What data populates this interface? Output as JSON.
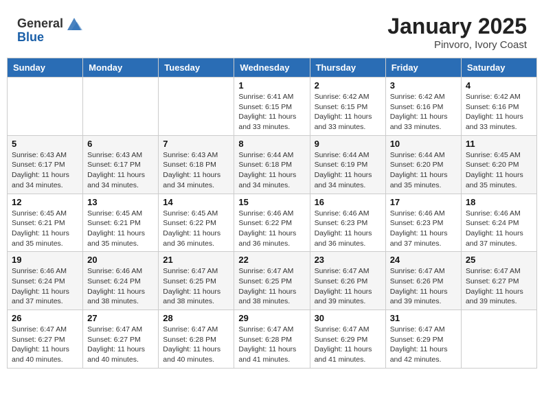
{
  "header": {
    "logo_general": "General",
    "logo_blue": "Blue",
    "month_year": "January 2025",
    "location": "Pinvoro, Ivory Coast"
  },
  "weekdays": [
    "Sunday",
    "Monday",
    "Tuesday",
    "Wednesday",
    "Thursday",
    "Friday",
    "Saturday"
  ],
  "weeks": [
    [
      {
        "day": "",
        "info": ""
      },
      {
        "day": "",
        "info": ""
      },
      {
        "day": "",
        "info": ""
      },
      {
        "day": "1",
        "info": "Sunrise: 6:41 AM\nSunset: 6:15 PM\nDaylight: 11 hours\nand 33 minutes."
      },
      {
        "day": "2",
        "info": "Sunrise: 6:42 AM\nSunset: 6:15 PM\nDaylight: 11 hours\nand 33 minutes."
      },
      {
        "day": "3",
        "info": "Sunrise: 6:42 AM\nSunset: 6:16 PM\nDaylight: 11 hours\nand 33 minutes."
      },
      {
        "day": "4",
        "info": "Sunrise: 6:42 AM\nSunset: 6:16 PM\nDaylight: 11 hours\nand 33 minutes."
      }
    ],
    [
      {
        "day": "5",
        "info": "Sunrise: 6:43 AM\nSunset: 6:17 PM\nDaylight: 11 hours\nand 34 minutes."
      },
      {
        "day": "6",
        "info": "Sunrise: 6:43 AM\nSunset: 6:17 PM\nDaylight: 11 hours\nand 34 minutes."
      },
      {
        "day": "7",
        "info": "Sunrise: 6:43 AM\nSunset: 6:18 PM\nDaylight: 11 hours\nand 34 minutes."
      },
      {
        "day": "8",
        "info": "Sunrise: 6:44 AM\nSunset: 6:18 PM\nDaylight: 11 hours\nand 34 minutes."
      },
      {
        "day": "9",
        "info": "Sunrise: 6:44 AM\nSunset: 6:19 PM\nDaylight: 11 hours\nand 34 minutes."
      },
      {
        "day": "10",
        "info": "Sunrise: 6:44 AM\nSunset: 6:20 PM\nDaylight: 11 hours\nand 35 minutes."
      },
      {
        "day": "11",
        "info": "Sunrise: 6:45 AM\nSunset: 6:20 PM\nDaylight: 11 hours\nand 35 minutes."
      }
    ],
    [
      {
        "day": "12",
        "info": "Sunrise: 6:45 AM\nSunset: 6:21 PM\nDaylight: 11 hours\nand 35 minutes."
      },
      {
        "day": "13",
        "info": "Sunrise: 6:45 AM\nSunset: 6:21 PM\nDaylight: 11 hours\nand 35 minutes."
      },
      {
        "day": "14",
        "info": "Sunrise: 6:45 AM\nSunset: 6:22 PM\nDaylight: 11 hours\nand 36 minutes."
      },
      {
        "day": "15",
        "info": "Sunrise: 6:46 AM\nSunset: 6:22 PM\nDaylight: 11 hours\nand 36 minutes."
      },
      {
        "day": "16",
        "info": "Sunrise: 6:46 AM\nSunset: 6:23 PM\nDaylight: 11 hours\nand 36 minutes."
      },
      {
        "day": "17",
        "info": "Sunrise: 6:46 AM\nSunset: 6:23 PM\nDaylight: 11 hours\nand 37 minutes."
      },
      {
        "day": "18",
        "info": "Sunrise: 6:46 AM\nSunset: 6:24 PM\nDaylight: 11 hours\nand 37 minutes."
      }
    ],
    [
      {
        "day": "19",
        "info": "Sunrise: 6:46 AM\nSunset: 6:24 PM\nDaylight: 11 hours\nand 37 minutes."
      },
      {
        "day": "20",
        "info": "Sunrise: 6:46 AM\nSunset: 6:24 PM\nDaylight: 11 hours\nand 38 minutes."
      },
      {
        "day": "21",
        "info": "Sunrise: 6:47 AM\nSunset: 6:25 PM\nDaylight: 11 hours\nand 38 minutes."
      },
      {
        "day": "22",
        "info": "Sunrise: 6:47 AM\nSunset: 6:25 PM\nDaylight: 11 hours\nand 38 minutes."
      },
      {
        "day": "23",
        "info": "Sunrise: 6:47 AM\nSunset: 6:26 PM\nDaylight: 11 hours\nand 39 minutes."
      },
      {
        "day": "24",
        "info": "Sunrise: 6:47 AM\nSunset: 6:26 PM\nDaylight: 11 hours\nand 39 minutes."
      },
      {
        "day": "25",
        "info": "Sunrise: 6:47 AM\nSunset: 6:27 PM\nDaylight: 11 hours\nand 39 minutes."
      }
    ],
    [
      {
        "day": "26",
        "info": "Sunrise: 6:47 AM\nSunset: 6:27 PM\nDaylight: 11 hours\nand 40 minutes."
      },
      {
        "day": "27",
        "info": "Sunrise: 6:47 AM\nSunset: 6:27 PM\nDaylight: 11 hours\nand 40 minutes."
      },
      {
        "day": "28",
        "info": "Sunrise: 6:47 AM\nSunset: 6:28 PM\nDaylight: 11 hours\nand 40 minutes."
      },
      {
        "day": "29",
        "info": "Sunrise: 6:47 AM\nSunset: 6:28 PM\nDaylight: 11 hours\nand 41 minutes."
      },
      {
        "day": "30",
        "info": "Sunrise: 6:47 AM\nSunset: 6:29 PM\nDaylight: 11 hours\nand 41 minutes."
      },
      {
        "day": "31",
        "info": "Sunrise: 6:47 AM\nSunset: 6:29 PM\nDaylight: 11 hours\nand 42 minutes."
      },
      {
        "day": "",
        "info": ""
      }
    ]
  ]
}
